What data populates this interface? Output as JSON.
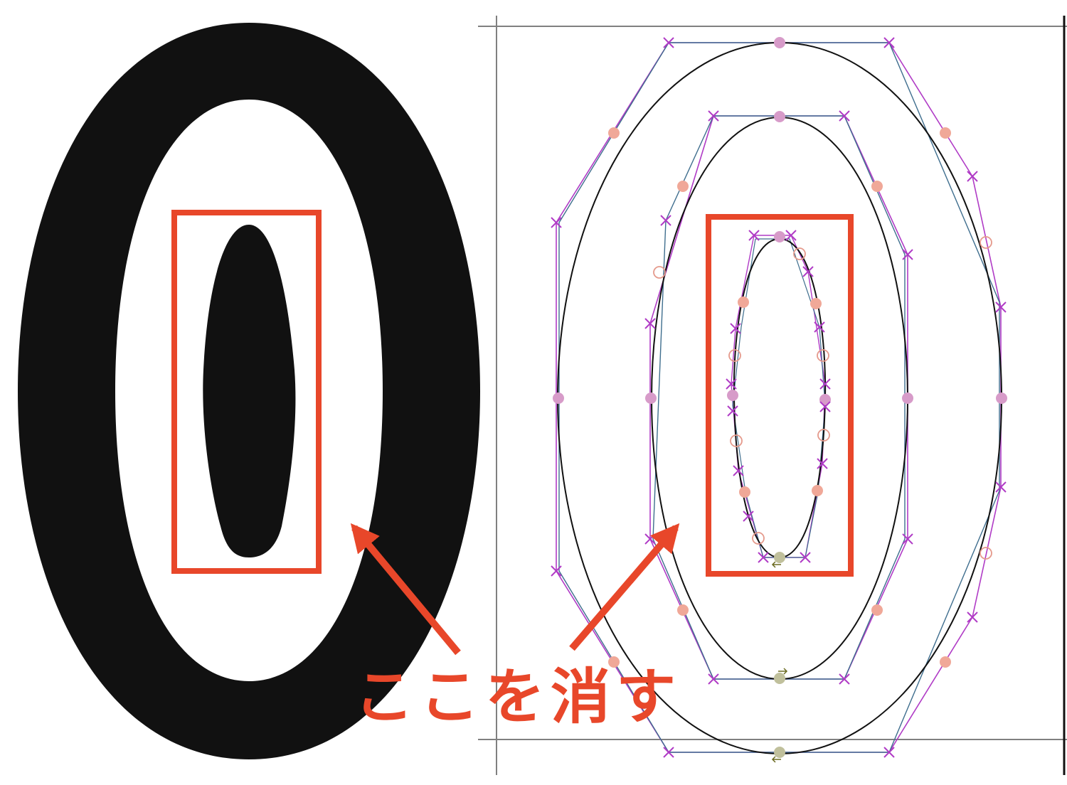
{
  "figure": {
    "glyph_character": "0",
    "annotation_text": "ここを消す",
    "glyph_fill_color": "#111111",
    "annotation_color": "#e8472a",
    "curve_color": "#111111",
    "guide_color": "#808080",
    "handle_line_colors": [
      "#b03bc6",
      "#3f6e8e"
    ],
    "point_colors": {
      "on_curve_smooth": "#d79bc9",
      "on_curve_alt": "#f0a898",
      "off_curve_marker": "#b03bc6",
      "start_point": "#c0c09c",
      "open_circle": "#e59a8c"
    }
  }
}
